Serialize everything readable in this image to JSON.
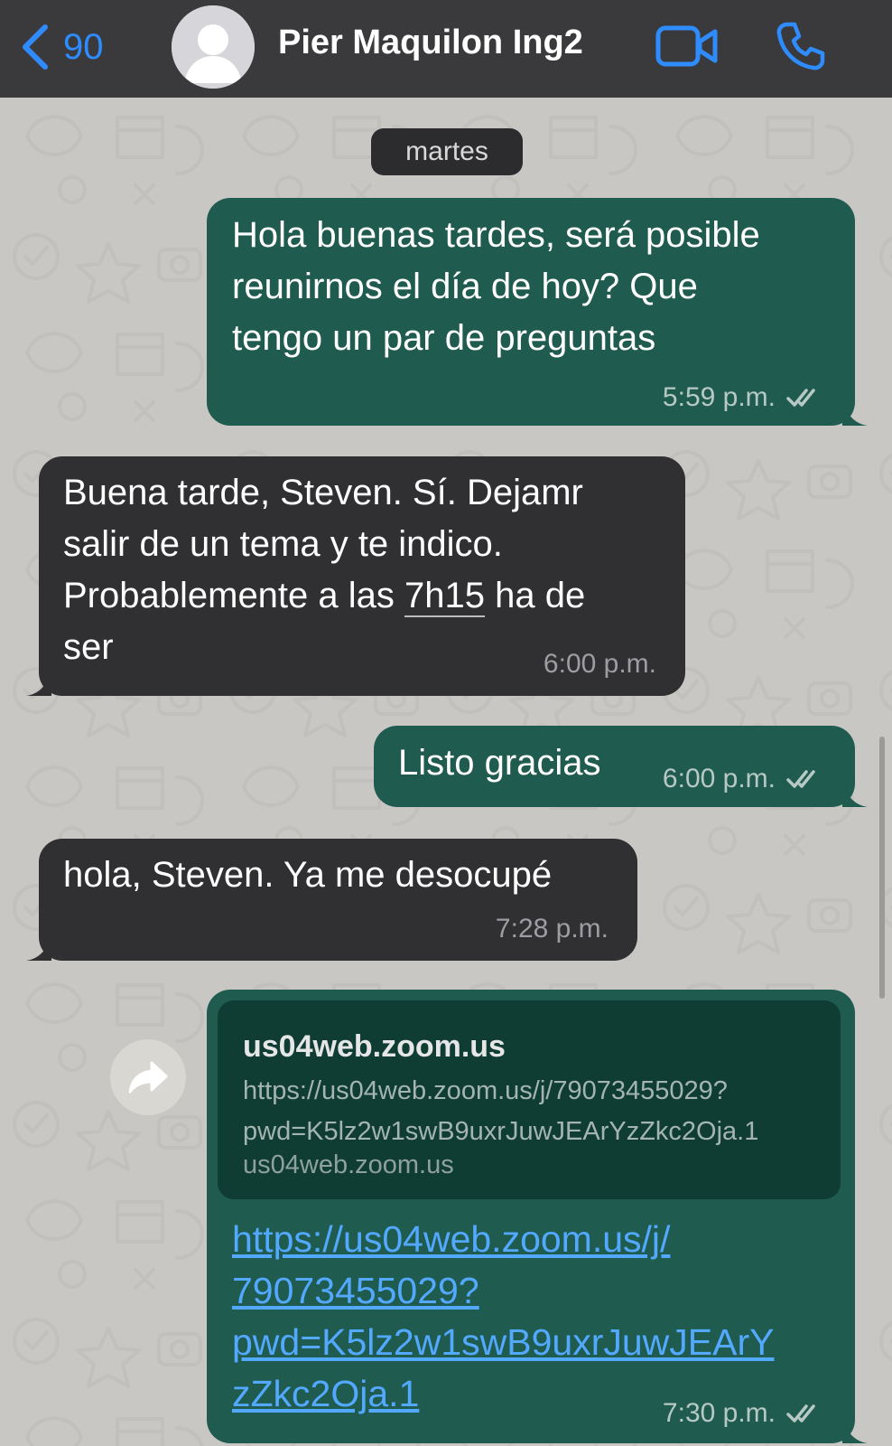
{
  "header": {
    "back_count": "90",
    "contact_name": "Pier Maquilon Ing2",
    "back_icon": "chevron-left-icon",
    "video_icon": "video-camera-icon",
    "call_icon": "phone-icon",
    "accent_color": "#2f8cff",
    "bar_color": "#3a3a3c"
  },
  "chat": {
    "date_separator": "martes",
    "background_color": "#c9c7c3",
    "outgoing_color": "#1f5c4f",
    "incoming_color": "#303033",
    "messages": [
      {
        "direction": "outgoing",
        "text_lines": [
          "Hola buenas tardes, será posible",
          "reunirnos el día de hoy? Que",
          "tengo un par de preguntas"
        ],
        "time": "5:59 p.m.",
        "status_icon": "double-check-icon"
      },
      {
        "direction": "incoming",
        "text_lines": [
          "Buena tarde, Steven. Sí. Dejamr",
          "salir de un tema y te indico.",
          "Probablemente a las ",
          "7h15",
          " ha de",
          "ser"
        ],
        "time": "6:00 p.m."
      },
      {
        "direction": "outgoing",
        "text_lines": [
          "Listo gracias"
        ],
        "time": "6:00 p.m.",
        "status_icon": "double-check-icon"
      },
      {
        "direction": "incoming",
        "text_lines": [
          "hola, Steven. Ya me desocupé"
        ],
        "time": "7:28 p.m."
      },
      {
        "direction": "outgoing",
        "link_preview": {
          "title": "us04web.zoom.us",
          "url_lines": [
            "https://us04web.zoom.us/j/79073455029?",
            "pwd=K5lz2w1swB9uxrJuwJEArYzZkc2Oja.1"
          ],
          "domain": "us04web.zoom.us"
        },
        "link_lines": [
          "https://us04web.zoom.us/j/",
          "79073455029?",
          "pwd=K5lz2w1swB9uxrJuwJEArY",
          "zZkc2Oja.1"
        ],
        "time": "7:30 p.m.",
        "status_icon": "double-check-icon",
        "forward_icon": "forward-arrow-icon"
      }
    ]
  }
}
